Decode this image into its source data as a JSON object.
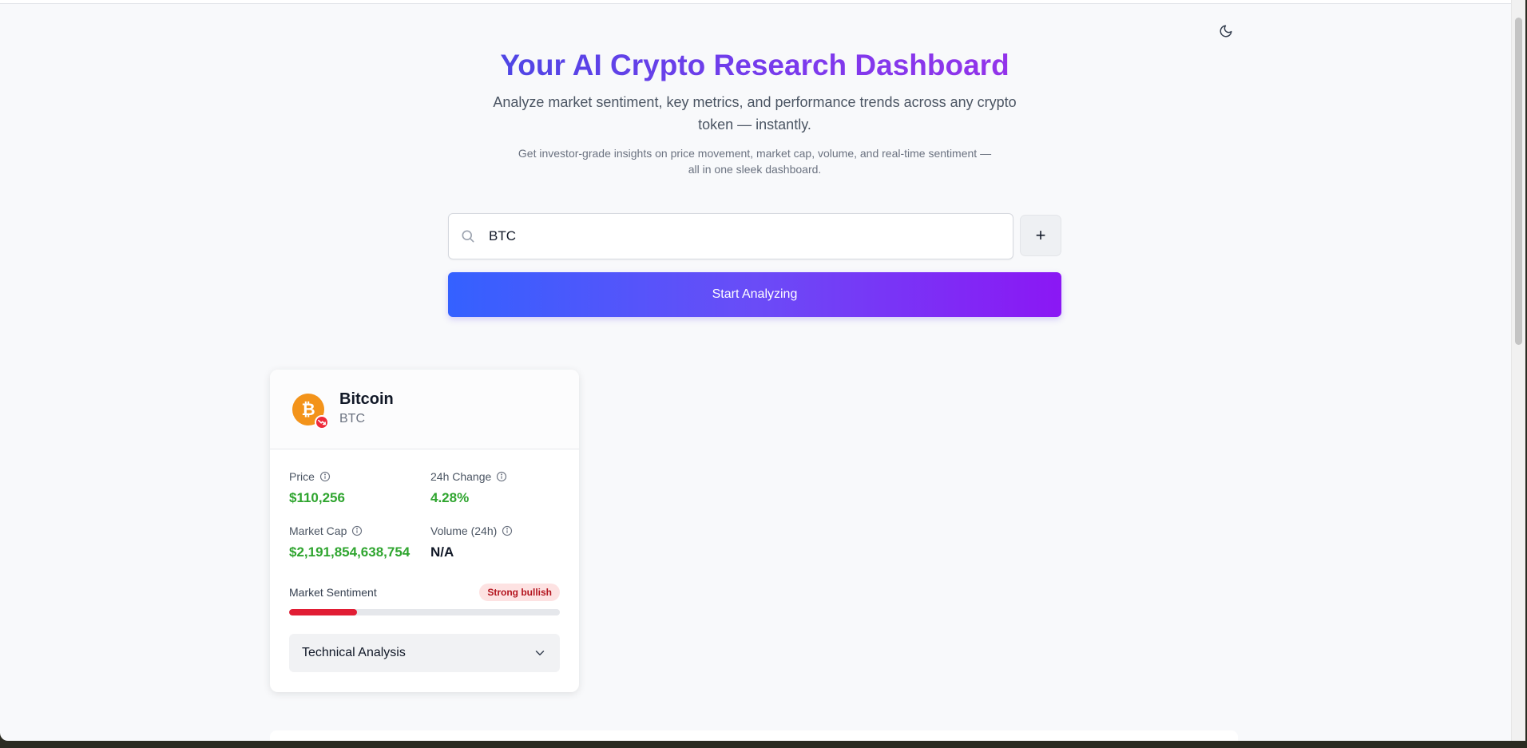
{
  "hero": {
    "title": "Your AI Crypto Research Dashboard",
    "subtitle": "Analyze market sentiment, key metrics, and performance trends across any crypto token — instantly.",
    "description": "Get investor-grade insights on price movement, market cap, volume, and real-time sentiment — all in one sleek dashboard."
  },
  "search": {
    "value": "BTC",
    "icon": "search-icon"
  },
  "add_button": {
    "label": "+"
  },
  "start_button": {
    "label": "Start Analyzing"
  },
  "theme_toggle": {
    "icon": "moon-icon"
  },
  "card": {
    "name": "Bitcoin",
    "symbol": "BTC",
    "logo_icon": "bitcoin-icon",
    "trend_icon": "trending-down-icon",
    "metrics": [
      {
        "label": "Price",
        "value": "$110,256",
        "color": "#2fa52f"
      },
      {
        "label": "24h Change",
        "value": "4.28%",
        "color": "#2fa52f"
      },
      {
        "label": "Market Cap",
        "value": "$2,191,854,638,754",
        "color": "#2fa52f"
      },
      {
        "label": "Volume (24h)",
        "value": "N/A",
        "color": "#111827"
      }
    ],
    "sentiment": {
      "label": "Market Sentiment",
      "badge": "Strong bullish",
      "level": 0.25,
      "color": "#e11d34"
    },
    "technical_analysis": {
      "label": "Technical Analysis",
      "expanded": false
    }
  },
  "colors": {
    "accent_start": "#3461ff",
    "accent_end": "#8b17f4",
    "positive": "#2fa52f",
    "negative": "#e11d34"
  }
}
